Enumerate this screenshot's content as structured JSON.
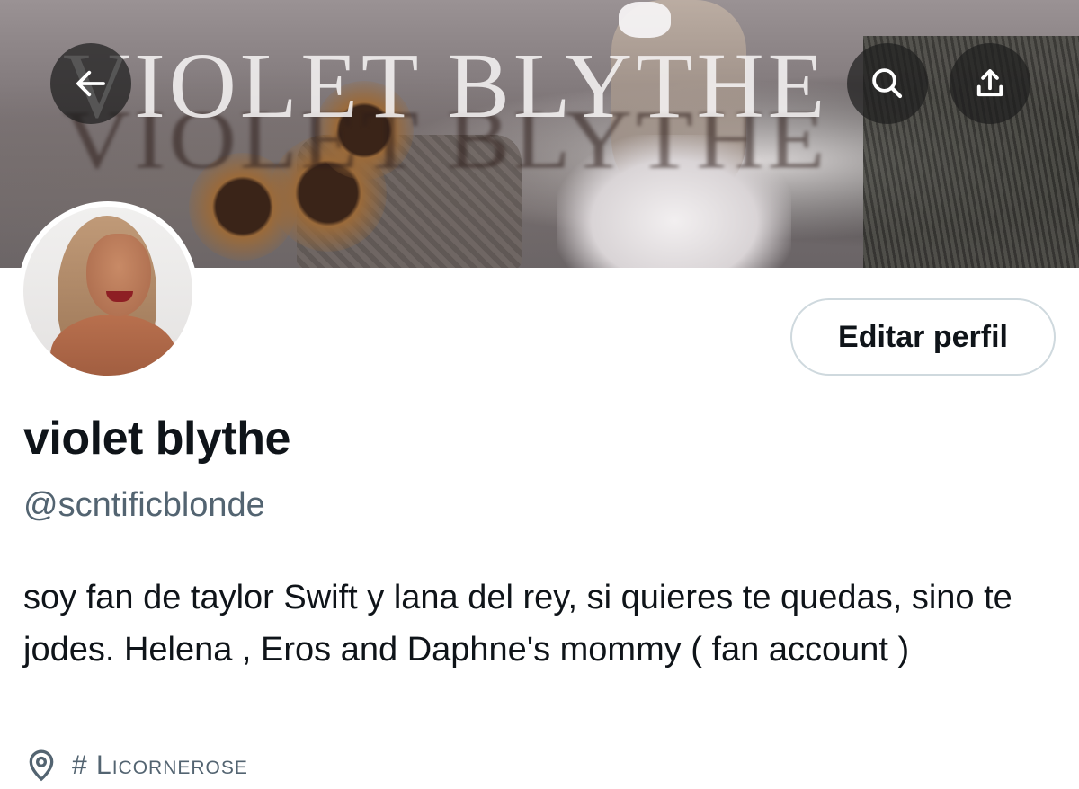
{
  "banner": {
    "title": "VIOLET BLYTHE"
  },
  "header": {
    "back_icon": "arrow-left-icon",
    "search_icon": "search-icon",
    "share_icon": "share-upload-icon"
  },
  "profile": {
    "display_name": "violet blythe",
    "handle": "@scntificblonde",
    "edit_button": "Editar perfil",
    "bio": "soy fan de taylor Swift y lana del rey, si quieres te quedas, sino te jodes. Helena , Eros and Daphne's mommy ( fan account )",
    "location": "# Licornerose",
    "location_icon": "map-pin-icon"
  },
  "colors": {
    "text_primary": "#0f1419",
    "text_secondary": "#536471",
    "button_border": "#cfd9de"
  }
}
